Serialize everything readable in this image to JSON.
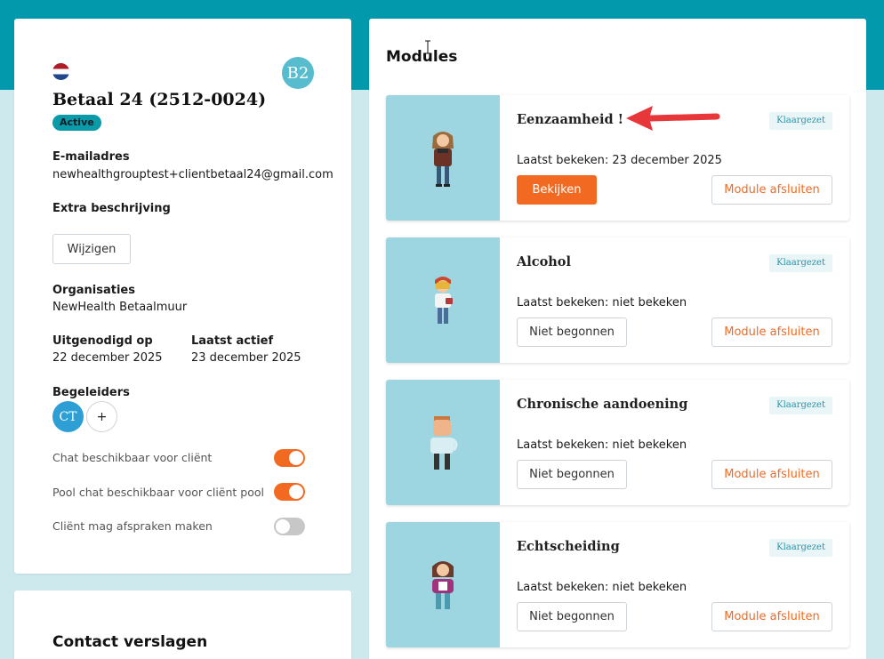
{
  "client": {
    "name": "Betaal 24 (2512-0024)",
    "status": "Active",
    "level_avatar": "B2",
    "flag_icon": "netherlands-flag-icon",
    "email_label": "E-mailadres",
    "email": "newhealthgrouptest+clientbetaal24@gmail.com",
    "extra_label": "Extra beschrijving",
    "edit_button": "Wijzigen",
    "org_label": "Organisaties",
    "org_value": "NewHealth Betaalmuur",
    "invited_label": "Uitgenodigd op",
    "invited_value": "22 december 2025",
    "last_active_label": "Laatst actief",
    "last_active_value": "23 december 2025",
    "coaches_label": "Begeleiders",
    "coach_initials": "CT",
    "add_coach": "+",
    "toggles": [
      {
        "label": "Chat beschikbaar voor cliënt",
        "on": true
      },
      {
        "label": "Pool chat beschikbaar voor cliënt pool",
        "on": true
      },
      {
        "label": "Cliënt mag afspraken maken",
        "on": false
      }
    ]
  },
  "contact": {
    "title": "Contact verslagen"
  },
  "modules": {
    "title": "Modules",
    "items": [
      {
        "name": "Eenzaamheid !",
        "tag": "Klaargezet",
        "seen": "Laatst bekeken: 23 december 2025",
        "action": "Bekijken",
        "action_primary": true,
        "close": "Module afsluiten",
        "illustration": "lonely-person-illustration"
      },
      {
        "name": "Alcohol",
        "tag": "Klaargezet",
        "seen": "Laatst bekeken: niet bekeken",
        "action": "Niet begonnen",
        "action_primary": false,
        "close": "Module afsluiten",
        "illustration": "alcohol-person-illustration"
      },
      {
        "name": "Chronische aandoening",
        "tag": "Klaargezet",
        "seen": "Laatst bekeken: niet bekeken",
        "action": "Niet begonnen",
        "action_primary": false,
        "close": "Module afsluiten",
        "illustration": "chronic-person-illustration"
      },
      {
        "name": "Echtscheiding",
        "tag": "Klaargezet",
        "seen": "Laatst bekeken: niet bekeken",
        "action": "Niet begonnen",
        "action_primary": false,
        "close": "Module afsluiten",
        "illustration": "divorce-person-illustration"
      }
    ]
  },
  "colors": {
    "brand_teal": "#0299ad",
    "accent_orange": "#f26a22",
    "annotation_red": "#e8373a"
  }
}
